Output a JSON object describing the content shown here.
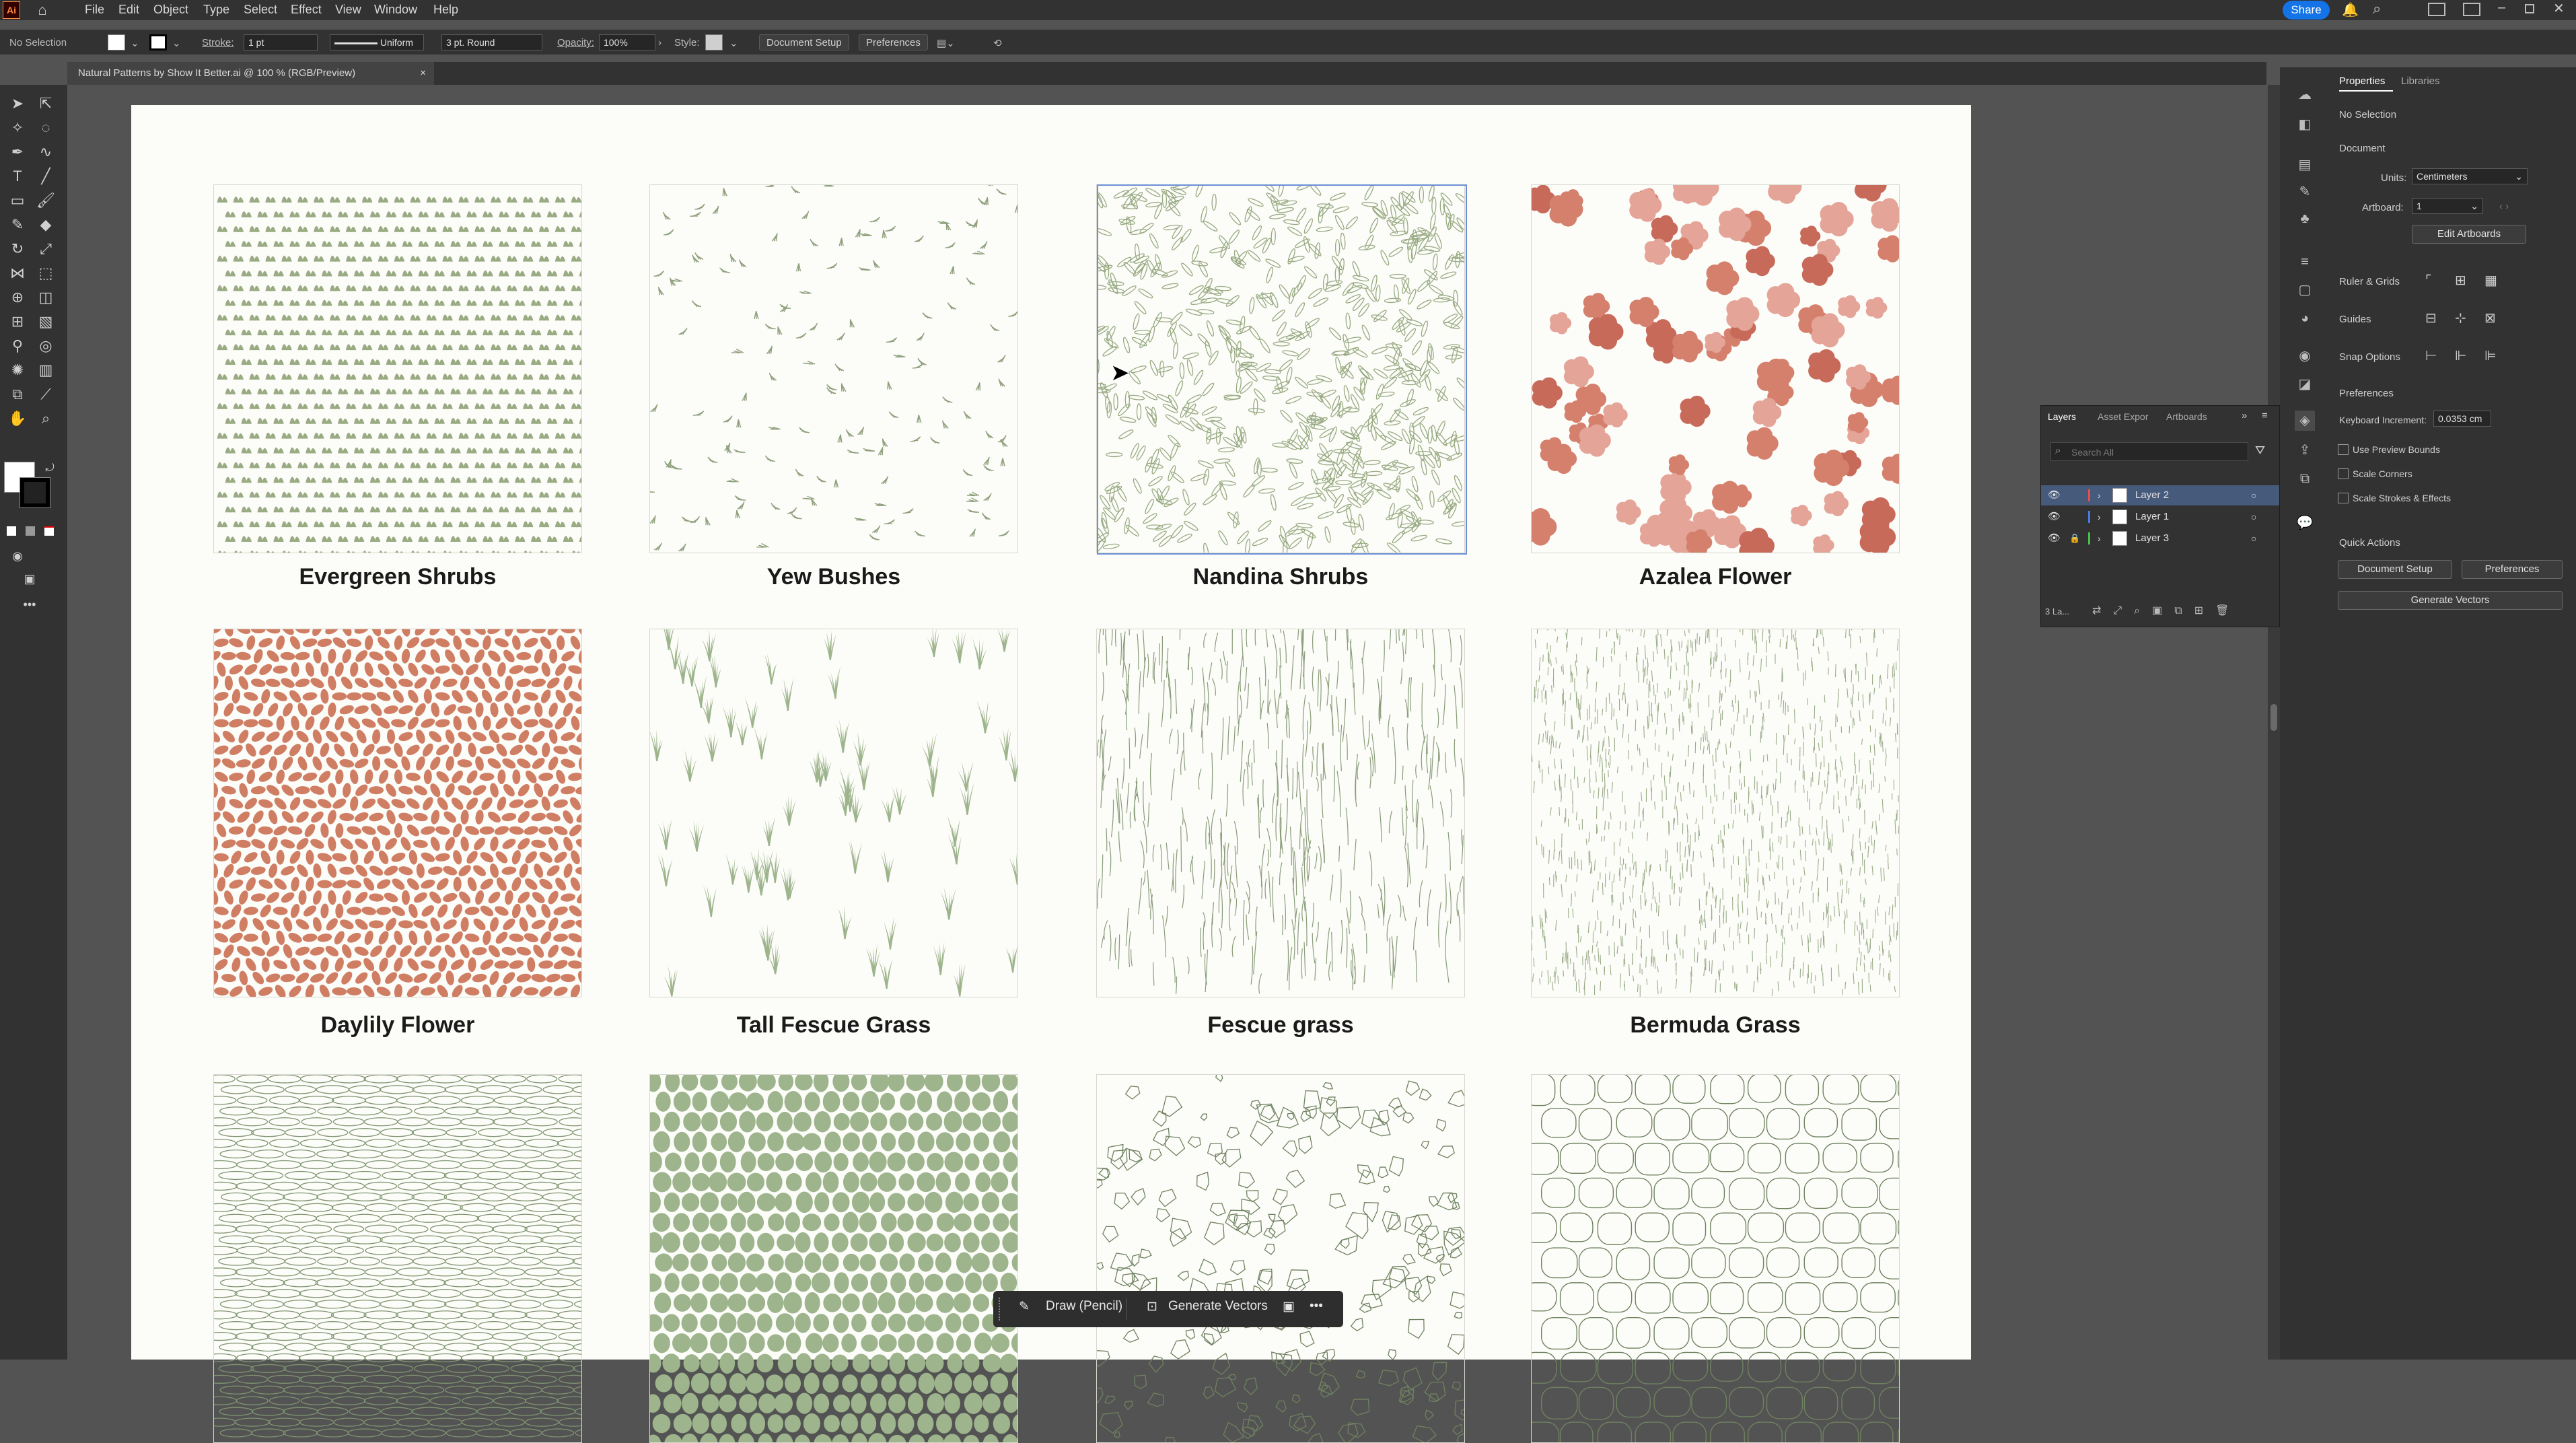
{
  "menubar": {
    "items": [
      "File",
      "Edit",
      "Object",
      "Type",
      "Select",
      "Effect",
      "View",
      "Window",
      "Help"
    ],
    "share_label": "Share"
  },
  "control": {
    "selection": "No Selection",
    "stroke_label": "Stroke:",
    "stroke_weight": "1 pt",
    "stroke_profile": "Uniform",
    "brush": "3 pt. Round",
    "opacity_label": "Opacity:",
    "opacity_value": "100%",
    "style_label": "Style:",
    "document_setup": "Document Setup",
    "preferences": "Preferences"
  },
  "document_tab": {
    "title": "Natural Patterns by Show It Better.ai @ 100 % (RGB/Preview)",
    "close": "×"
  },
  "patterns": [
    {
      "label": "Evergreen Shrubs",
      "kind": "shrub",
      "color": "#9aab84"
    },
    {
      "label": "Yew Bushes",
      "kind": "tufts",
      "color": "#8e9f7c"
    },
    {
      "label": "Nandina Shrubs",
      "kind": "leaves",
      "color": "#98aa82"
    },
    {
      "label": "Azalea Flower",
      "kind": "flower",
      "color": "#d4806c"
    },
    {
      "label": "Daylily Flower",
      "kind": "petals",
      "color": "#cf7e63"
    },
    {
      "label": "Tall Fescue Grass",
      "kind": "grass",
      "color": "#9db48c"
    },
    {
      "label": "Fescue grass",
      "kind": "lines",
      "color": "#8a9c7a"
    },
    {
      "label": "Bermuda Grass",
      "kind": "dense",
      "color": "#9aac88"
    },
    {
      "label": "",
      "kind": "ovals",
      "color": "#7f9470"
    },
    {
      "label": "",
      "kind": "pebbles",
      "color": "#9db48c"
    },
    {
      "label": "",
      "kind": "shards",
      "color": "#6f8260"
    },
    {
      "label": "",
      "kind": "stones",
      "color": "#6f8260"
    }
  ],
  "properties": {
    "tabs": [
      "Properties",
      "Libraries"
    ],
    "selection": "No Selection",
    "document_heading": "Document",
    "units_label": "Units:",
    "units_value": "Centimeters",
    "artboard_label": "Artboard:",
    "artboard_value": "1",
    "edit_artboards": "Edit Artboards",
    "ruler_grids": "Ruler & Grids",
    "guides": "Guides",
    "snap_options": "Snap Options",
    "preferences_heading": "Preferences",
    "keyboard_increment_label": "Keyboard Increment:",
    "keyboard_increment_value": "0.0353 cm",
    "use_preview_bounds": "Use Preview Bounds",
    "scale_corners": "Scale Corners",
    "scale_strokes": "Scale Strokes & Effects",
    "quick_actions": "Quick Actions",
    "document_setup": "Document Setup",
    "preferences_btn": "Preferences",
    "generate_vectors": "Generate Vectors"
  },
  "layers_panel": {
    "tabs": [
      "Layers",
      "Asset Expor",
      "Artboards"
    ],
    "search_placeholder": "Search All",
    "rows": [
      {
        "name": "Layer 2",
        "color": "#e5504a",
        "selected": true,
        "locked": false
      },
      {
        "name": "Layer 1",
        "color": "#4a7be5",
        "selected": false,
        "locked": false
      },
      {
        "name": "Layer 3",
        "color": "#49c24a",
        "selected": false,
        "locked": true
      }
    ],
    "count": "3 La..."
  },
  "context_bar": {
    "draw_label": "Draw (Pencil)",
    "generate_label": "Generate Vectors",
    "more": "•••"
  }
}
